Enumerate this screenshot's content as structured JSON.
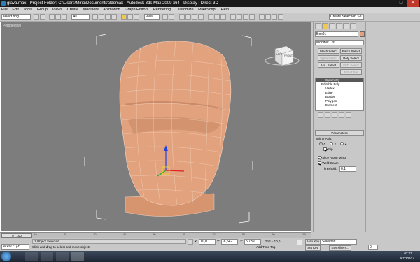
{
  "window": {
    "title": "glava.max - Project Folder: C:\\Users\\Mirio\\Documents\\3dsmax - Autodesk 3ds Max 2009 x64 - Display : Direct 3D",
    "min_glyph": "–",
    "max_glyph": "□",
    "close_glyph": "✕"
  },
  "menu": [
    "File",
    "Edit",
    "Tools",
    "Group",
    "Views",
    "Create",
    "Modifiers",
    "Animation",
    "Graph Editors",
    "Rendering",
    "Customize",
    "MAXScript",
    "Help"
  ],
  "toolbar": {
    "selection_set_value": "select ring",
    "filter_value": "All",
    "reference_coord_value": "View",
    "named_selection_placeholder": "Create Selection Se"
  },
  "viewport": {
    "label": "Perspective",
    "viewcube_top": "LEFT",
    "viewcube_front": "FRONT"
  },
  "command_panel": {
    "object_name": "Box01",
    "modifier_list": "Modifier List",
    "buttons": {
      "mesh_select": "Mesh Select",
      "patch_select": "Patch Select",
      "spline_select": "SplineSelect",
      "poly_select": "Poly Select",
      "vol_select": "Vol. Select",
      "ffd_select": "FFD Select",
      "nsurf_sel": "NSurf Sel"
    },
    "stack": {
      "symmetry": "Symmetry",
      "editable_poly": "Editable Poly",
      "sub": [
        "Vertex",
        "Edge",
        "Border",
        "Polygon",
        "Element"
      ]
    },
    "parameters": {
      "title": "Parameters",
      "mirror_axis": "Mirror Axis:",
      "axis_x": "X",
      "axis_y": "Y",
      "axis_z": "Z",
      "flip": "Flip",
      "slice": "Slice Along Mirror",
      "weld": "Weld Seam",
      "threshold_label": "Threshold:",
      "threshold_value": "0,1"
    }
  },
  "timeline": {
    "frame": "0 / 100",
    "ticks": [
      "0",
      "10",
      "20",
      "30",
      "40",
      "50",
      "60",
      "70",
      "80",
      "90",
      "100"
    ]
  },
  "status": {
    "maxscript": "MAXScript.",
    "selected": "1 Object Selected",
    "prompt": "Click and drag to select and move objects",
    "x_label": "X:",
    "x_value": "10,0",
    "y_label": "Y:",
    "y_value": "-6,542",
    "z_label": "Z:",
    "z_value": "5,739",
    "grid": "Grid = 10,0",
    "add_time_tag": "Add Time Tag",
    "auto_key": "Auto Key",
    "set_key": "Set Key",
    "selected_dropdown": "Selected",
    "key_filters": "Key Filters...",
    "frame_field": "0"
  },
  "taskbar": {
    "time": "02:23",
    "date": "9.7.2010 г."
  },
  "colors": {
    "viewport_bg": "#7d7d7d",
    "mesh_skin": "#e2a27e",
    "selection_yellow": "#f0c850"
  }
}
